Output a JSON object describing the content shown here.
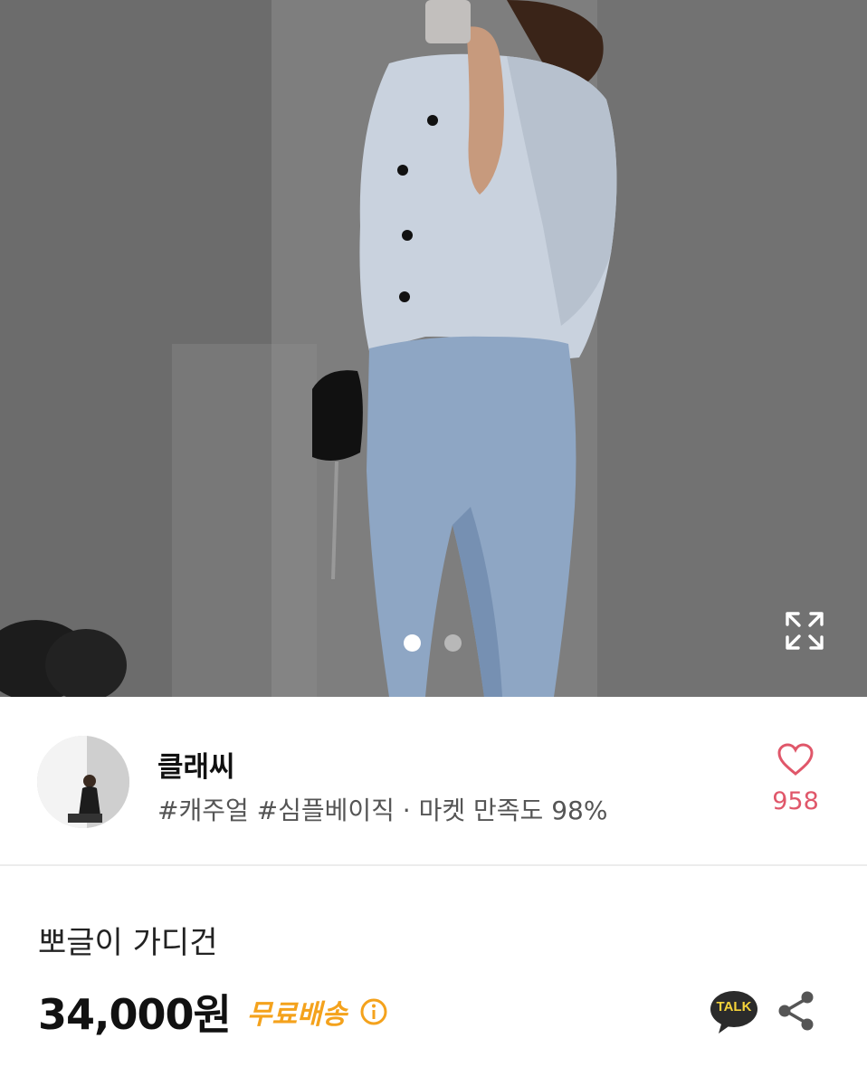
{
  "product_image": {
    "description_icon": "product-photo",
    "carousel": {
      "total": 2,
      "current": 1
    },
    "expand_icon": "expand-icon"
  },
  "store": {
    "name": "클래씨",
    "tags": "#캐주얼 #심플베이직 · 마켓 만족도 98%",
    "likes": "958",
    "like_icon": "heart-icon"
  },
  "product": {
    "title": "뽀글이 가디건",
    "price": "34,000원",
    "shipping": "무료배송",
    "info_icon": "info-icon",
    "talk_label": "TALK",
    "share_icon": "share-icon"
  },
  "colors": {
    "shipping": "#f4a21c",
    "like": "#e0576a",
    "talk_bg": "#2b2b2b",
    "talk_text": "#f5d33a"
  }
}
